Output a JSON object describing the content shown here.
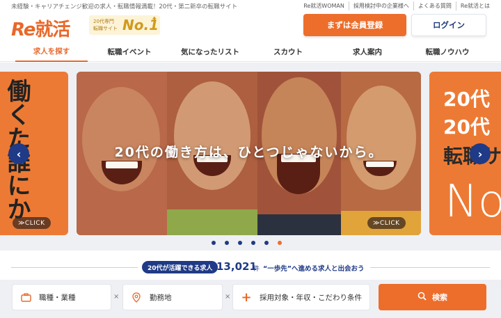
{
  "top": {
    "tagline": "未経験・キャリアチェンジ歓迎の求人・転職情報満載！20代・第二新卒の転職サイト",
    "links": [
      "Re就活WOMAN",
      "採用検討中の企業様へ",
      "よくある質問",
      "Re就活とは"
    ]
  },
  "header": {
    "logo_re": "Re",
    "logo_text": "就活",
    "badge_sub": "20代専門\n転職サイト",
    "badge_main": "No.1",
    "register_label": "まずは会員登録",
    "login_label": "ログイン"
  },
  "nav": {
    "items": [
      "求人を探す",
      "転職イベント",
      "気になったリスト",
      "スカウト",
      "求人案内",
      "転職ノウハウ"
    ],
    "active": 0
  },
  "carousel": {
    "caption": "20代の働き方は、ひとつじゃないから。",
    "click_label": "≫CLICK",
    "left_slide_text": "働くた誰にか",
    "right_slide_lines": [
      "20代",
      "20代",
      "転職サ"
    ],
    "right_slide_big": "No",
    "prev_icon": "chevron-left-icon",
    "next_icon": "chevron-right-icon",
    "dot_count": 6,
    "active_dot": 5
  },
  "count": {
    "badge": "20代が活躍できる求人",
    "number": "13,021",
    "unit": "件",
    "desc": "“一歩先”へ進める求人と出会おう"
  },
  "search": {
    "field_job": "職種・業種",
    "field_location": "勤務地",
    "field_conditions": "採用対象・年収・こだわり条件",
    "clear_mark": "×",
    "button_label": "検索"
  },
  "colors": {
    "accent": "#ed6e2b",
    "navy": "#1f3a86"
  }
}
